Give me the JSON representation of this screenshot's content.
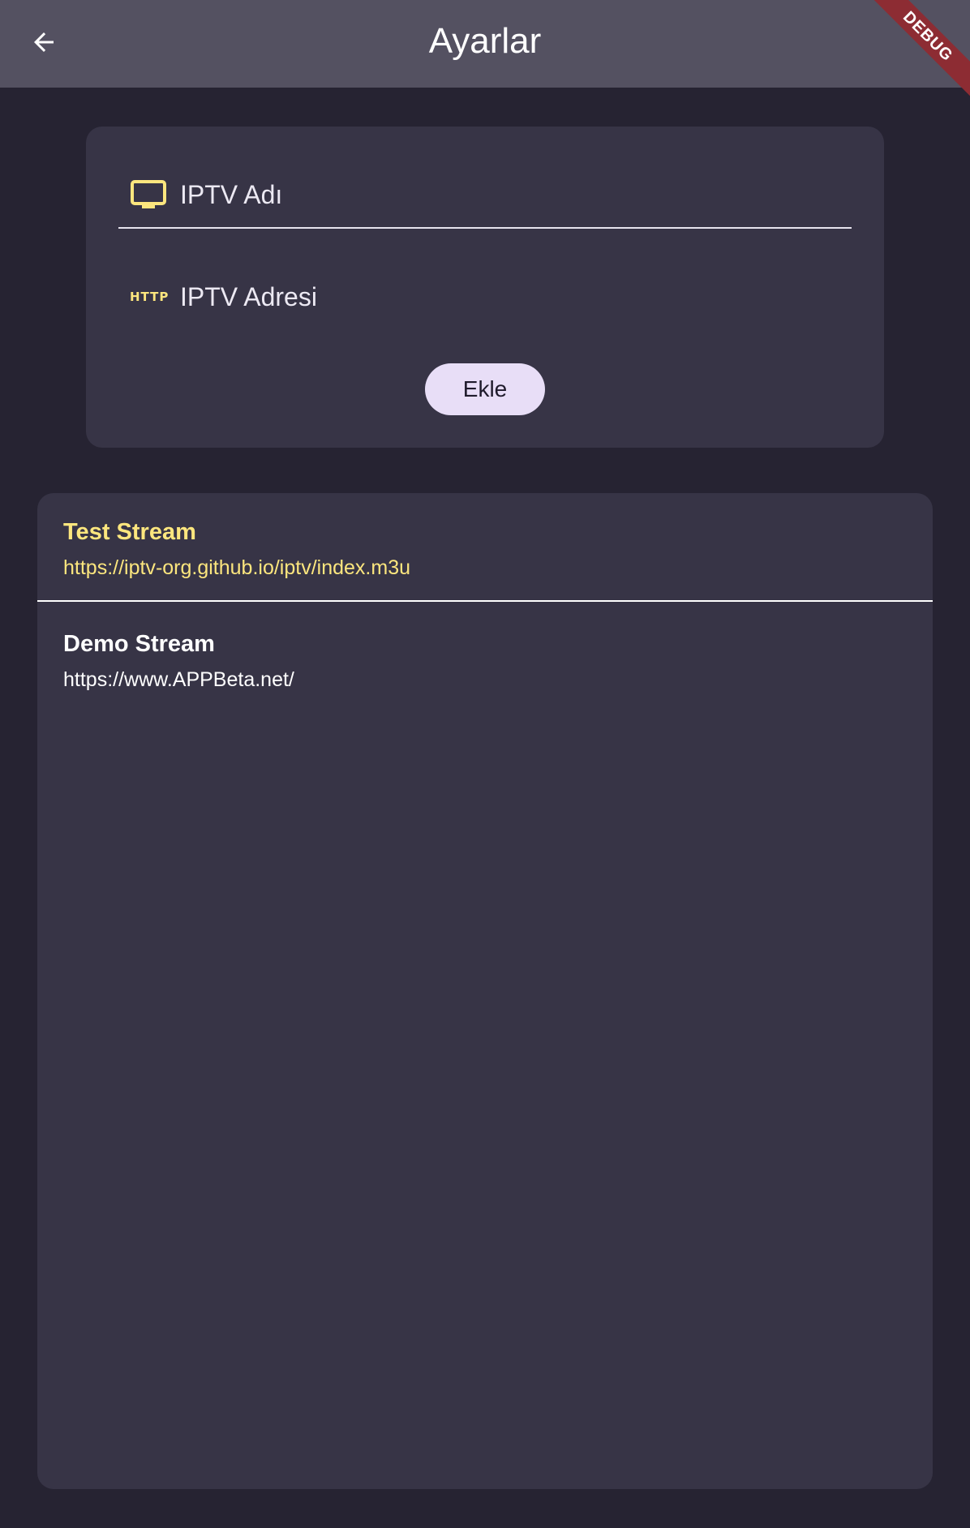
{
  "appbar": {
    "title": "Ayarlar",
    "back_icon": "arrow-back-icon",
    "debug_banner": "DEBUG"
  },
  "form": {
    "name_placeholder": "IPTV Adı",
    "name_icon": "tv-icon",
    "address_placeholder": "IPTV Adresi",
    "address_icon": "http-icon",
    "address_icon_text": "HTTP",
    "add_button_label": "Ekle"
  },
  "streams": [
    {
      "name": "Test Stream",
      "url": "https://iptv-org.github.io/iptv/index.m3u",
      "selected": true
    },
    {
      "name": "Demo Stream",
      "url": "https://www.APPBeta.net/",
      "selected": false
    }
  ],
  "colors": {
    "appbar": "#545161",
    "background": "#262332",
    "card": "#373446",
    "accent": "#fce67e",
    "button": "#e8def7",
    "debug_ribbon": "#8d2c33"
  }
}
